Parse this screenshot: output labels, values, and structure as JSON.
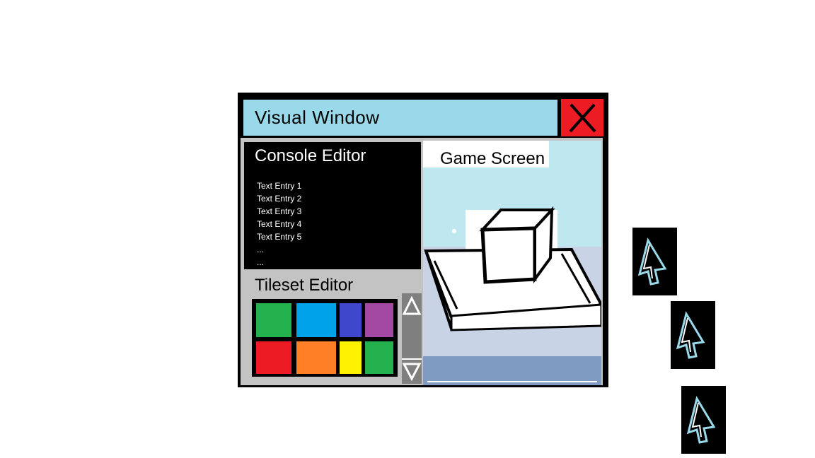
{
  "window": {
    "title": "Visual Window",
    "close_icon": "close-x-icon"
  },
  "console_editor": {
    "title": "Console Editor",
    "entries": [
      "Text Entry 1",
      "Text Entry 2",
      "Text Entry 3",
      "Text Entry 4",
      "Text Entry 5",
      "...",
      "..."
    ]
  },
  "tileset_editor": {
    "title": "Tileset Editor",
    "tiles": [
      "#22b14c",
      "#00a2e8",
      "#3f48cc",
      "#a349a4",
      "#ed1c24",
      "#ff7f27",
      "#fff200",
      "#22b14c"
    ],
    "scroll_up_icon": "arrow-up-icon",
    "scroll_down_icon": "arrow-down-icon"
  },
  "game_screen": {
    "title": "Game Screen"
  },
  "cursor_icons": [
    "mouse-pointer-icon",
    "mouse-pointer-icon",
    "mouse-pointer-icon"
  ],
  "colors": {
    "title_bar": "#99d9ea",
    "close_button": "#ed1c24",
    "panel_bg": "#c3c3c3",
    "sky": "#bfe7f0",
    "floor": "#7f9bc2"
  }
}
